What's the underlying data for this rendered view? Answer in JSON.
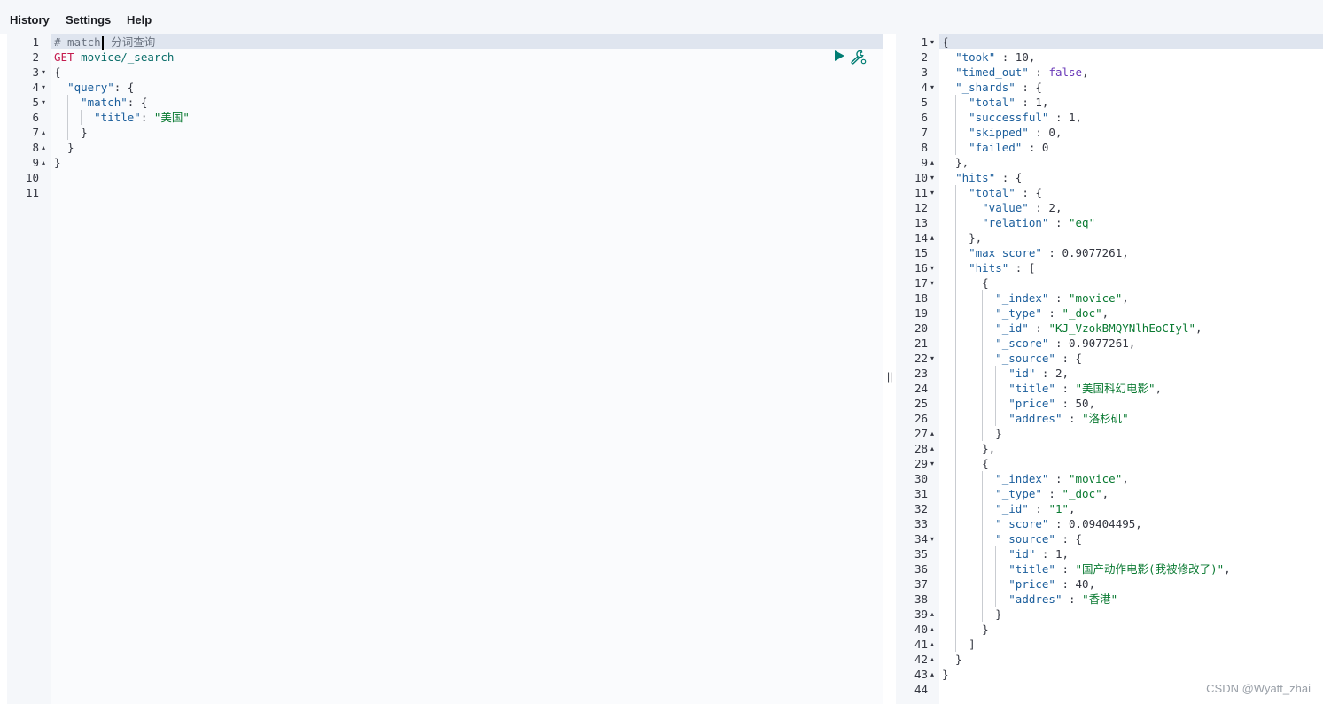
{
  "menu": [
    "History",
    "Settings",
    "Help"
  ],
  "request": {
    "lines": [
      [
        [
          "cm",
          "# match"
        ],
        [
          "cursor",
          ""
        ],
        [
          "cm",
          " 分词查询"
        ]
      ],
      [
        [
          "method",
          "GET"
        ],
        [
          "url",
          " movice/_search"
        ]
      ],
      [
        [
          "n",
          "{"
        ]
      ],
      [
        [
          "n",
          "  "
        ],
        [
          "k",
          "\"query\""
        ],
        [
          "n",
          ": {"
        ]
      ],
      [
        [
          "n",
          "    "
        ],
        [
          "k",
          "\"match\""
        ],
        [
          "n",
          ": {"
        ]
      ],
      [
        [
          "n",
          "      "
        ],
        [
          "k",
          "\"title\""
        ],
        [
          "n",
          ": "
        ],
        [
          "s",
          "\"美国\""
        ]
      ],
      [
        [
          "n",
          "    }"
        ]
      ],
      [
        [
          "n",
          "  }"
        ]
      ],
      [
        [
          "n",
          "}"
        ]
      ],
      [],
      []
    ],
    "folds": [
      "",
      "",
      "▾",
      "▾",
      "▾",
      "",
      "▴",
      "▴",
      "▴",
      "",
      ""
    ]
  },
  "response": {
    "lines": [
      [
        [
          "n",
          "{"
        ]
      ],
      [
        [
          "n",
          "  "
        ],
        [
          "k",
          "\"took\""
        ],
        [
          "n",
          " : 10,"
        ]
      ],
      [
        [
          "n",
          "  "
        ],
        [
          "k",
          "\"timed_out\""
        ],
        [
          "n",
          " : "
        ],
        [
          "kw",
          "false"
        ],
        [
          "n",
          ","
        ]
      ],
      [
        [
          "n",
          "  "
        ],
        [
          "k",
          "\"_shards\""
        ],
        [
          "n",
          " : {"
        ]
      ],
      [
        [
          "n",
          "    "
        ],
        [
          "k",
          "\"total\""
        ],
        [
          "n",
          " : 1,"
        ]
      ],
      [
        [
          "n",
          "    "
        ],
        [
          "k",
          "\"successful\""
        ],
        [
          "n",
          " : 1,"
        ]
      ],
      [
        [
          "n",
          "    "
        ],
        [
          "k",
          "\"skipped\""
        ],
        [
          "n",
          " : 0,"
        ]
      ],
      [
        [
          "n",
          "    "
        ],
        [
          "k",
          "\"failed\""
        ],
        [
          "n",
          " : 0"
        ]
      ],
      [
        [
          "n",
          "  },"
        ]
      ],
      [
        [
          "n",
          "  "
        ],
        [
          "k",
          "\"hits\""
        ],
        [
          "n",
          " : {"
        ]
      ],
      [
        [
          "n",
          "    "
        ],
        [
          "k",
          "\"total\""
        ],
        [
          "n",
          " : {"
        ]
      ],
      [
        [
          "n",
          "      "
        ],
        [
          "k",
          "\"value\""
        ],
        [
          "n",
          " : 2,"
        ]
      ],
      [
        [
          "n",
          "      "
        ],
        [
          "k",
          "\"relation\""
        ],
        [
          "n",
          " : "
        ],
        [
          "s",
          "\"eq\""
        ]
      ],
      [
        [
          "n",
          "    },"
        ]
      ],
      [
        [
          "n",
          "    "
        ],
        [
          "k",
          "\"max_score\""
        ],
        [
          "n",
          " : 0.9077261,"
        ]
      ],
      [
        [
          "n",
          "    "
        ],
        [
          "k",
          "\"hits\""
        ],
        [
          "n",
          " : ["
        ]
      ],
      [
        [
          "n",
          "      {"
        ]
      ],
      [
        [
          "n",
          "        "
        ],
        [
          "k",
          "\"_index\""
        ],
        [
          "n",
          " : "
        ],
        [
          "s",
          "\"movice\""
        ],
        [
          "n",
          ","
        ]
      ],
      [
        [
          "n",
          "        "
        ],
        [
          "k",
          "\"_type\""
        ],
        [
          "n",
          " : "
        ],
        [
          "s",
          "\"_doc\""
        ],
        [
          "n",
          ","
        ]
      ],
      [
        [
          "n",
          "        "
        ],
        [
          "k",
          "\"_id\""
        ],
        [
          "n",
          " : "
        ],
        [
          "s",
          "\"KJ_VzokBMQYNlhEoCIyl\""
        ],
        [
          "n",
          ","
        ]
      ],
      [
        [
          "n",
          "        "
        ],
        [
          "k",
          "\"_score\""
        ],
        [
          "n",
          " : 0.9077261,"
        ]
      ],
      [
        [
          "n",
          "        "
        ],
        [
          "k",
          "\"_source\""
        ],
        [
          "n",
          " : {"
        ]
      ],
      [
        [
          "n",
          "          "
        ],
        [
          "k",
          "\"id\""
        ],
        [
          "n",
          " : 2,"
        ]
      ],
      [
        [
          "n",
          "          "
        ],
        [
          "k",
          "\"title\""
        ],
        [
          "n",
          " : "
        ],
        [
          "s",
          "\"美国科幻电影\""
        ],
        [
          "n",
          ","
        ]
      ],
      [
        [
          "n",
          "          "
        ],
        [
          "k",
          "\"price\""
        ],
        [
          "n",
          " : 50,"
        ]
      ],
      [
        [
          "n",
          "          "
        ],
        [
          "k",
          "\"addres\""
        ],
        [
          "n",
          " : "
        ],
        [
          "s",
          "\"洛杉矶\""
        ]
      ],
      [
        [
          "n",
          "        }"
        ]
      ],
      [
        [
          "n",
          "      },"
        ]
      ],
      [
        [
          "n",
          "      {"
        ]
      ],
      [
        [
          "n",
          "        "
        ],
        [
          "k",
          "\"_index\""
        ],
        [
          "n",
          " : "
        ],
        [
          "s",
          "\"movice\""
        ],
        [
          "n",
          ","
        ]
      ],
      [
        [
          "n",
          "        "
        ],
        [
          "k",
          "\"_type\""
        ],
        [
          "n",
          " : "
        ],
        [
          "s",
          "\"_doc\""
        ],
        [
          "n",
          ","
        ]
      ],
      [
        [
          "n",
          "        "
        ],
        [
          "k",
          "\"_id\""
        ],
        [
          "n",
          " : "
        ],
        [
          "s",
          "\"1\""
        ],
        [
          "n",
          ","
        ]
      ],
      [
        [
          "n",
          "        "
        ],
        [
          "k",
          "\"_score\""
        ],
        [
          "n",
          " : 0.09404495,"
        ]
      ],
      [
        [
          "n",
          "        "
        ],
        [
          "k",
          "\"_source\""
        ],
        [
          "n",
          " : {"
        ]
      ],
      [
        [
          "n",
          "          "
        ],
        [
          "k",
          "\"id\""
        ],
        [
          "n",
          " : 1,"
        ]
      ],
      [
        [
          "n",
          "          "
        ],
        [
          "k",
          "\"title\""
        ],
        [
          "n",
          " : "
        ],
        [
          "s",
          "\"国产动作电影(我被修改了)\""
        ],
        [
          "n",
          ","
        ]
      ],
      [
        [
          "n",
          "          "
        ],
        [
          "k",
          "\"price\""
        ],
        [
          "n",
          " : 40,"
        ]
      ],
      [
        [
          "n",
          "          "
        ],
        [
          "k",
          "\"addres\""
        ],
        [
          "n",
          " : "
        ],
        [
          "s",
          "\"香港\""
        ]
      ],
      [
        [
          "n",
          "        }"
        ]
      ],
      [
        [
          "n",
          "      }"
        ]
      ],
      [
        [
          "n",
          "    ]"
        ]
      ],
      [
        [
          "n",
          "  }"
        ]
      ],
      [
        [
          "n",
          "}"
        ]
      ],
      []
    ],
    "folds": [
      "▾",
      "",
      "",
      "▾",
      "",
      "",
      "",
      "",
      "▴",
      "▾",
      "▾",
      "",
      "",
      "▴",
      "",
      "▾",
      "▾",
      "",
      "",
      "",
      "",
      "▾",
      "",
      "",
      "",
      "",
      "▴",
      "▴",
      "▾",
      "",
      "",
      "",
      "",
      "▾",
      "",
      "",
      "",
      "",
      "▴",
      "▴",
      "▴",
      "▴",
      "▴",
      ""
    ]
  },
  "resizer_glyph": "||",
  "watermark": "CSDN @Wyatt_zhai",
  "colors": {
    "play": "#017d73",
    "active_line": "#dfe5ef",
    "gutter": "#f5f7fa"
  }
}
